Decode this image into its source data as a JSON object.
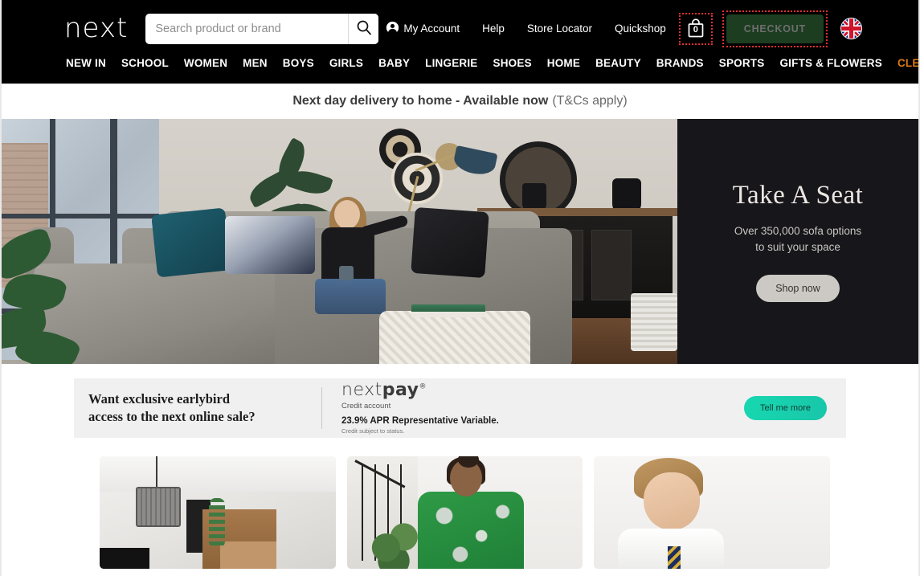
{
  "header": {
    "brand": "next",
    "search": {
      "placeholder": "Search product or brand",
      "value": "",
      "icon": "search-icon"
    },
    "utility_links": [
      {
        "label": "My Account",
        "icon": "account-person-icon"
      },
      {
        "label": "Help",
        "icon": ""
      },
      {
        "label": "Store Locator",
        "icon": ""
      },
      {
        "label": "Quickshop",
        "icon": ""
      }
    ],
    "bag": {
      "count": "0",
      "icon": "shopping-bag-icon",
      "highlighted": true
    },
    "checkout": {
      "label": "CHECKOUT",
      "highlighted": true,
      "bg_color": "#1c3d20",
      "text_color": "#6e6e6e",
      "disabled": true
    },
    "locale": {
      "icon": "uk-flag-icon",
      "country": "United Kingdom"
    },
    "highlight_color": "#e03030"
  },
  "nav": {
    "items": [
      {
        "label": "NEW IN",
        "accent": false
      },
      {
        "label": "SCHOOL",
        "accent": false
      },
      {
        "label": "WOMEN",
        "accent": false
      },
      {
        "label": "MEN",
        "accent": false
      },
      {
        "label": "BOYS",
        "accent": false
      },
      {
        "label": "GIRLS",
        "accent": false
      },
      {
        "label": "BABY",
        "accent": false
      },
      {
        "label": "LINGERIE",
        "accent": false
      },
      {
        "label": "SHOES",
        "accent": false
      },
      {
        "label": "HOME",
        "accent": false
      },
      {
        "label": "BEAUTY",
        "accent": false
      },
      {
        "label": "BRANDS",
        "accent": false
      },
      {
        "label": "SPORTS",
        "accent": false
      },
      {
        "label": "GIFTS & FLOWERS",
        "accent": false
      },
      {
        "label": "CLEARANCE",
        "accent": true
      }
    ],
    "accent_color": "#d97a12"
  },
  "delivery_bar": {
    "bold_text": "Next day delivery to home - Available now",
    "light_text": "(T&Cs apply)"
  },
  "hero": {
    "photo_alt": "Woman sitting on a grey corner sofa in a bright living room",
    "title": "Take A Seat",
    "subtitle": "Over 350,000 sofa options\nto suit your space",
    "subtitle_line1": "Over 350,000 sofa options",
    "subtitle_line2": "to suit your space",
    "cta": "Shop now",
    "panel_bg": "#17161a"
  },
  "nextpay_banner": {
    "headline_line1": "Want exclusive earlybird",
    "headline_line2": "access to the next online sale?",
    "logo_light": "next",
    "logo_bold": "pay",
    "logo_mark": "®",
    "sub_credit": "Credit account",
    "sub_apr": "23.9% APR Representative Variable.",
    "sub_status": "Credit subject to status.",
    "cta": "Tell me more",
    "cta_color": "#17d8b0",
    "bg_color": "#f0f0f0"
  },
  "tiles": [
    {
      "alt": "Home interior with wire pendant lamp",
      "name": "tile-home"
    },
    {
      "alt": "Woman wearing green paisley print dress",
      "name": "tile-women"
    },
    {
      "alt": "Boy smiling in white school shirt and tie",
      "name": "tile-school"
    }
  ]
}
